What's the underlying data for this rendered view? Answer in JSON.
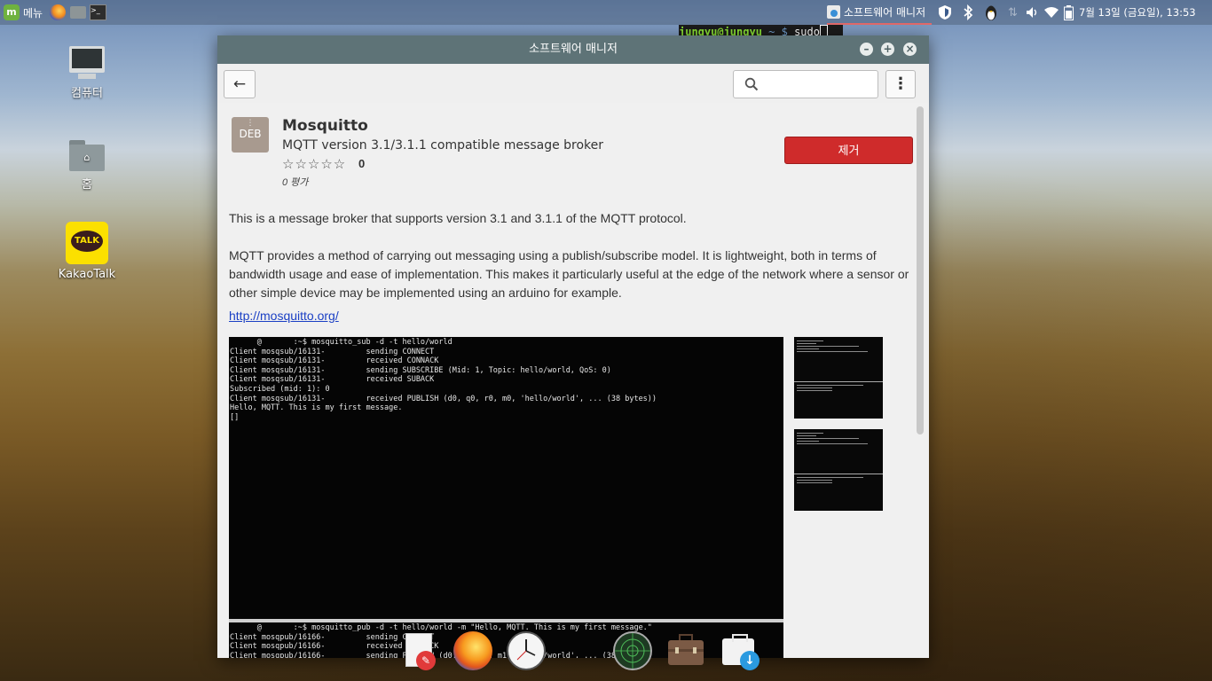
{
  "panel": {
    "menu_label": "메뉴",
    "active_window": "소프트웨어 매니저",
    "datetime": "7월 13일 (금요일), 13:53"
  },
  "desktop": {
    "icons": [
      {
        "label": "컴퓨터"
      },
      {
        "label": "홈"
      },
      {
        "label": "KakaoTalk",
        "badge_text": "TALK"
      }
    ]
  },
  "terminal": {
    "prompt_user": "jungyu@jungyu",
    "prompt_path": "~ $",
    "command": "sudo"
  },
  "window": {
    "title": "소프트웨어 매니저",
    "search_value": ""
  },
  "app": {
    "icon_text": "DEB",
    "name": "Mosquitto",
    "summary": "MQTT version 3.1/3.1.1 compatible message broker",
    "stars": "☆☆☆☆☆",
    "rating_count": "0",
    "reviews_label": "0 평가",
    "remove_label": "제거",
    "description_1": "This is a message broker that supports version 3.1 and 3.1.1 of the MQTT protocol.",
    "description_2": "MQTT provides a method of carrying out messaging using a publish/subscribe model. It is lightweight, both in terms of bandwidth usage and ease of implementation. This makes it particularly useful at the edge of the network where a sensor or other simple device may be implemented using an arduino for example.",
    "homepage": "http://mosquitto.org/",
    "screenshot_top": [
      "      @       :~$ mosquitto_sub -d -t hello/world",
      "Client mosqsub/16131-         sending CONNECT",
      "Client mosqsub/16131-         received CONNACK",
      "Client mosqsub/16131-         sending SUBSCRIBE (Mid: 1, Topic: hello/world, QoS: 0)",
      "Client mosqsub/16131-         received SUBACK",
      "Subscribed (mid: 1): 0",
      "Client mosqsub/16131-         received PUBLISH (d0, q0, r0, m0, 'hello/world', ... (38 bytes))",
      "Hello, MQTT. This is my first message.",
      "[]"
    ],
    "screenshot_bottom": [
      "      @       :~$ mosquitto_pub -d -t hello/world -m \"Hello, MQTT. This is my first message.\"",
      "Client mosqpub/16166-         sending CONNECT",
      "Client mosqpub/16166-         received CONNACK",
      "Client mosqpub/16166-         sending PUBLISH (d0, q0, r0, m1, 'hello/world', ... (38 bytes))"
    ]
  },
  "dock": {
    "items": [
      "notes-icon",
      "firefox-icon",
      "clock-icon",
      "network-radar-icon",
      "briefcase-icon",
      "software-install-icon"
    ]
  }
}
